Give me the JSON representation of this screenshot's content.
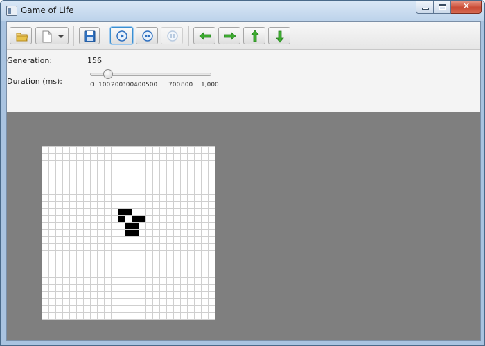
{
  "window": {
    "title": "Game of Life",
    "close_glyph": "✕"
  },
  "toolbar": {
    "buttons": [
      {
        "name": "open-button",
        "icon": "folder-icon",
        "state": "normal"
      },
      {
        "name": "new-pattern-dropdown-button",
        "icon": "new-document-icon",
        "state": "normal"
      },
      {
        "name": "save-button",
        "icon": "floppy-disk-icon",
        "state": "normal"
      },
      {
        "name": "play-button",
        "icon": "play-circle-icon",
        "state": "focused"
      },
      {
        "name": "fast-forward-button",
        "icon": "fast-forward-circle-icon",
        "state": "normal"
      },
      {
        "name": "pause-button",
        "icon": "pause-circle-icon",
        "state": "disabled"
      },
      {
        "name": "move-left-button",
        "icon": "arrow-left-icon",
        "state": "normal"
      },
      {
        "name": "move-right-button",
        "icon": "arrow-right-icon",
        "state": "normal"
      },
      {
        "name": "move-up-button",
        "icon": "arrow-up-icon",
        "state": "normal"
      },
      {
        "name": "move-down-button",
        "icon": "arrow-down-icon",
        "state": "normal"
      }
    ]
  },
  "generation": {
    "label": "Generation:",
    "value": "156"
  },
  "duration": {
    "label": "Duration (ms):",
    "value": 100,
    "min": 0,
    "max": 1000,
    "tick_labels": [
      "0",
      "100",
      "200",
      "300",
      "400",
      "500",
      "700",
      "800",
      "1,000"
    ]
  },
  "board": {
    "columns": 25,
    "rows": 25,
    "live_cells": [
      [
        11,
        9
      ],
      [
        12,
        9
      ],
      [
        11,
        10
      ],
      [
        13,
        10
      ],
      [
        14,
        10
      ],
      [
        12,
        11
      ],
      [
        13,
        11
      ],
      [
        12,
        12
      ],
      [
        13,
        12
      ],
      [
        11,
        10
      ]
    ],
    "live_color": "#000000",
    "dead_color": "#ffffff",
    "grid_line_color": "#cfcfcf",
    "background_color": "#7f7f7f"
  },
  "colors": {
    "accent": "#3b8fd0",
    "arrow_green": "#3cab2f",
    "save_blue": "#2d6fbf",
    "folder_yellow": "#e8c24a"
  }
}
